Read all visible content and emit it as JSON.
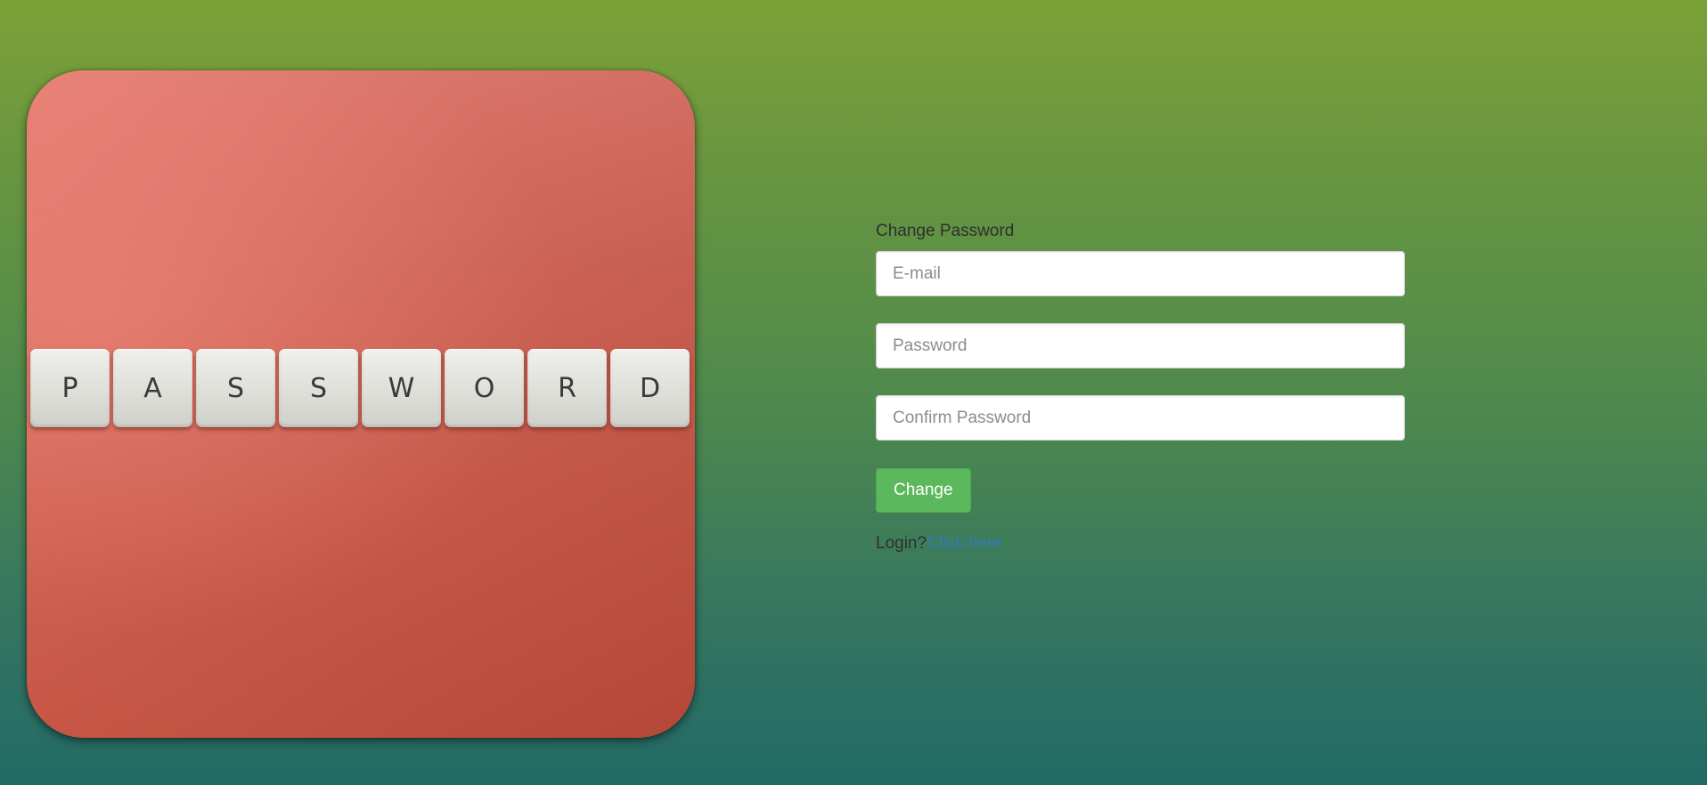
{
  "hero": {
    "keys": [
      "P",
      "A",
      "S",
      "S",
      "W",
      "O",
      "R",
      "D"
    ]
  },
  "form": {
    "title": "Change Password",
    "email_placeholder": "E-mail",
    "password_placeholder": "Password",
    "confirm_placeholder": "Confirm Password",
    "submit_label": "Change",
    "login_prompt": "Login?",
    "login_link": "Click here"
  },
  "colors": {
    "button": "#5cb85c",
    "link": "#337ab7",
    "hero_background": "#d25f50"
  }
}
